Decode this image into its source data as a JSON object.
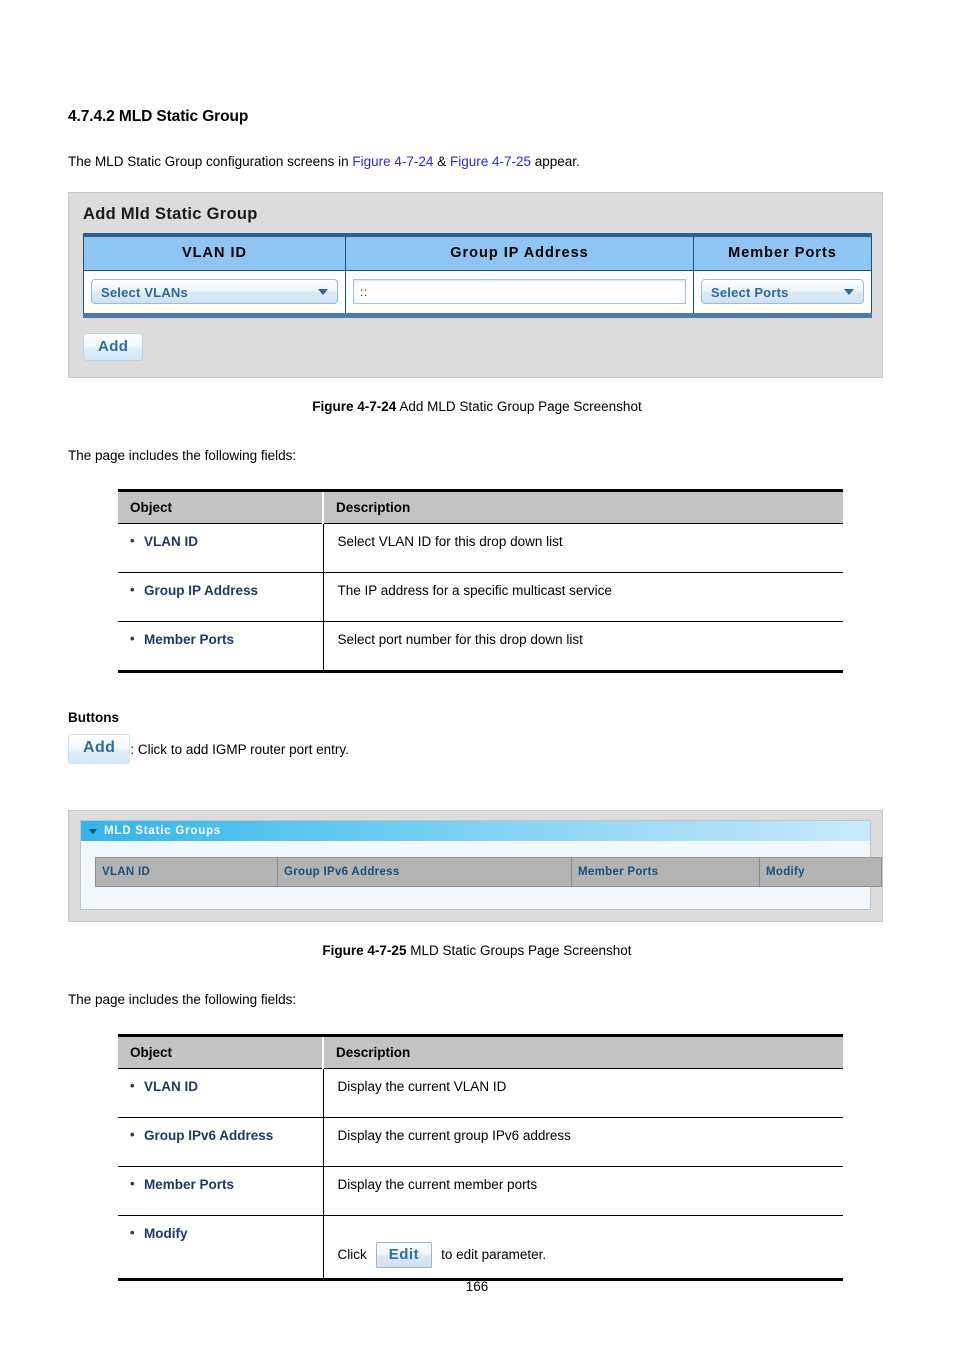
{
  "document": {
    "section_number_title": "4.7.4.2 MLD Static Group",
    "intro_prefix": "The MLD Static Group configuration screens in ",
    "figure_ref_1": "Figure 4-7-24",
    "intro_amp": " & ",
    "figure_ref_2": "Figure 4-7-25",
    "intro_suffix": " appear.",
    "fields_intro_1": "The page includes the following fields:",
    "fields_intro_2": "The page includes the following fields:",
    "page_number": "166"
  },
  "figure1": {
    "panel_title": "Add Mld Static Group",
    "columns": {
      "vlan_id": "VLAN ID",
      "group_ip_address": "Group IP Address",
      "member_ports": "Member Ports"
    },
    "vlan_select_value": "Select VLANs",
    "group_ip_value": "::",
    "ports_select_value": "Select Ports",
    "add_button_label": "Add",
    "caption_bold": "Figure 4-7-24",
    "caption_text": " Add MLD Static Group Page Screenshot"
  },
  "table1": {
    "headers": {
      "object": "Object",
      "description": "Description"
    },
    "rows": [
      {
        "object": "VLAN ID",
        "description": "Select VLAN ID for this drop down list"
      },
      {
        "object": "Group IP Address",
        "description": "The IP address for a specific multicast service"
      },
      {
        "object": "Member Ports",
        "description": "Select port number for this drop down list"
      }
    ]
  },
  "buttons_section": {
    "heading": "Buttons",
    "add_button_label": "Add",
    "add_button_description": ": Click to add IGMP router port entry."
  },
  "figure2": {
    "panel_title": "MLD Static Groups",
    "grid_headers": {
      "vlan_id": "VLAN ID",
      "group_ipv6_address": "Group IPv6 Address",
      "member_ports": "Member Ports",
      "modify": "Modify"
    },
    "caption_bold": "Figure 4-7-25",
    "caption_text": " MLD Static Groups Page Screenshot"
  },
  "table2": {
    "headers": {
      "object": "Object",
      "description": "Description"
    },
    "rows": [
      {
        "object": "VLAN ID",
        "description": "Display the current VLAN ID"
      },
      {
        "object": "Group IPv6 Address",
        "description": "Display the current group IPv6 address"
      },
      {
        "object": "Member Ports",
        "description": "Display the current member ports"
      }
    ],
    "modify_row": {
      "object": "Modify",
      "prefix": "Click",
      "edit_button_label": "Edit",
      "suffix": "to edit parameter."
    }
  },
  "colors": {
    "figure_link": "#2b2bd4",
    "table_header_bg": "#c3c3c3",
    "object_label": "#1f3864",
    "panel_header_blue": "#8ec5f2",
    "panel_title_gradient_start": "#34b3e8",
    "grid_header_bg": "#b3b3b3",
    "grid_header_text": "#1f4e79",
    "button_text": "#2e6da4"
  }
}
